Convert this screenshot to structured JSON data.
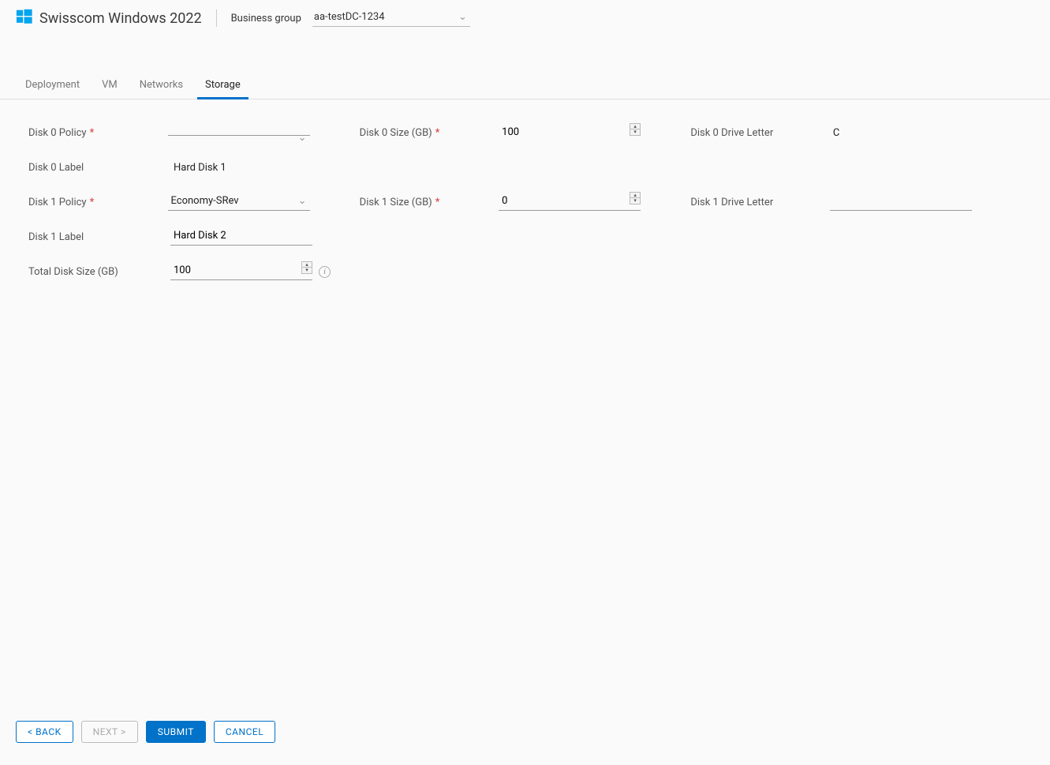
{
  "header": {
    "title": "Swisscom Windows 2022",
    "businessGroupLabel": "Business group",
    "businessGroupValue": "aa-testDC-1234"
  },
  "tabs": [
    "Deployment",
    "VM",
    "Networks",
    "Storage"
  ],
  "activeTab": "Storage",
  "form": {
    "disk0PolicyLabel": "Disk 0 Policy",
    "disk0PolicyValue": "",
    "disk0SizeLabel": "Disk 0 Size (GB)",
    "disk0SizeValue": "100",
    "disk0DriveLetterLabel": "Disk 0 Drive Letter",
    "disk0DriveLetterValue": "C",
    "disk0LabelLabel": "Disk 0 Label",
    "disk0LabelValue": "Hard Disk 1",
    "disk1PolicyLabel": "Disk 1 Policy",
    "disk1PolicyValue": "Economy-SRev",
    "disk1SizeLabel": "Disk 1 Size (GB)",
    "disk1SizeValue": "0",
    "disk1DriveLetterLabel": "Disk 1 Drive Letter",
    "disk1DriveLetterValue": "",
    "disk1LabelLabel": "Disk 1 Label",
    "disk1LabelValue": "Hard Disk 2",
    "totalDiskSizeLabel": "Total Disk Size (GB)",
    "totalDiskSizeValue": "100"
  },
  "footer": {
    "back": "< BACK",
    "next": "NEXT >",
    "submit": "SUBMIT",
    "cancel": "CANCEL"
  }
}
